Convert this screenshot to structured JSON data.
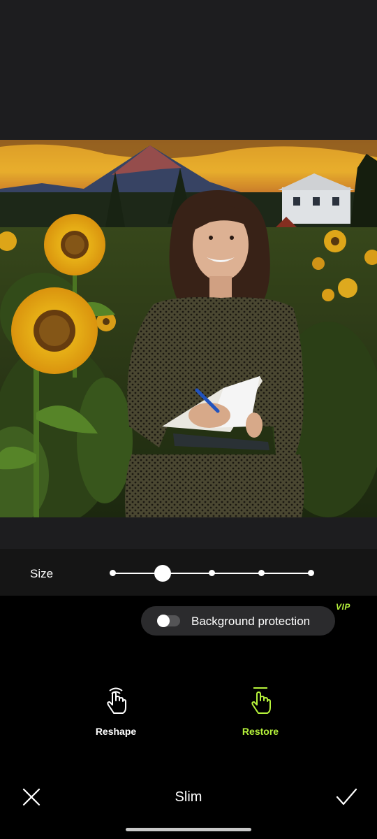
{
  "size_control": {
    "label": "Size",
    "levels": 5,
    "selected_level": 2
  },
  "background_protection": {
    "label": "Background protection",
    "enabled": false,
    "badge": "VIP"
  },
  "tools": [
    {
      "label": "Reshape",
      "icon": "hand-reshape-icon",
      "active": false,
      "color": "#ffffff"
    },
    {
      "label": "Restore",
      "icon": "hand-restore-icon",
      "active": true,
      "color": "#b6f33b"
    }
  ],
  "bottom_bar": {
    "title": "Slim",
    "close_icon": "close-icon",
    "confirm_icon": "check-icon"
  },
  "colors": {
    "accent": "#b6f33b",
    "canvas_bg": "#1d1d1f",
    "panel_bg": "#000000"
  }
}
